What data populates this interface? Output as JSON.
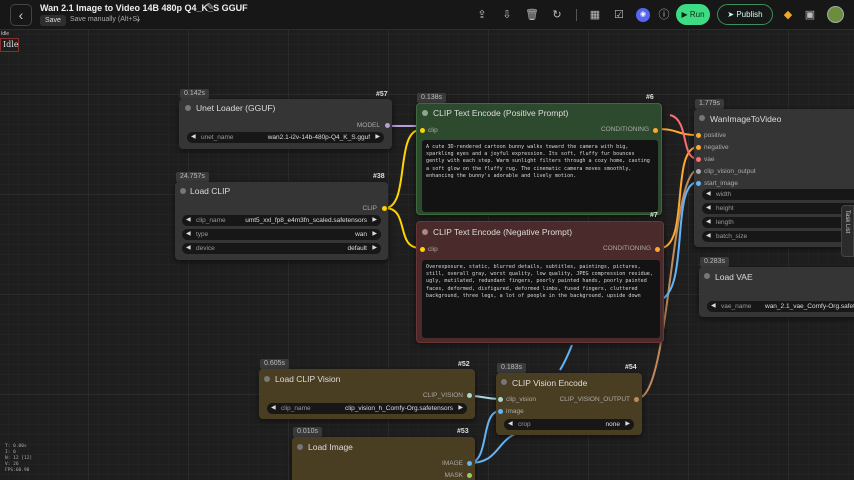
{
  "topbar": {
    "title": "Wan 2.1 Image to Video 14B 480p Q4_K_S GGUF",
    "save_label": "Save",
    "save_manually": "Save manually (Alt+S)",
    "run_label": "Run",
    "publish_label": "Publish"
  },
  "status": {
    "idle_small": "Idle",
    "idle_box": "Idle"
  },
  "stats": {
    "line1": "T: 0.00s",
    "line2": "I: 0",
    "line3": "N: 12 [12]",
    "line4": "V: 26",
    "line5": "FPS:60.98"
  },
  "nodes": {
    "unet_loader": {
      "timing": "0.142s",
      "id": "#57",
      "title": "Unet Loader (GGUF)",
      "output": "MODEL",
      "widgets": [
        {
          "name": "unet_name",
          "value": "wan2.1-i2v-14b-480p-Q4_K_S.gguf"
        }
      ]
    },
    "load_clip": {
      "timing": "24.757s",
      "id": "#38",
      "title": "Load CLIP",
      "output": "CLIP",
      "widgets": [
        {
          "name": "clip_name",
          "value": "umt5_xxl_fp8_e4m3fn_scaled.safetensors"
        },
        {
          "name": "type",
          "value": "wan"
        },
        {
          "name": "device",
          "value": "default"
        }
      ]
    },
    "clip_pos": {
      "timing": "0.138s",
      "id": "#6",
      "title": "CLIP Text Encode (Positive Prompt)",
      "input": "clip",
      "output": "CONDITIONING",
      "text": "A cute 3D-rendered cartoon bunny walks toward the camera with big, sparkling eyes and a joyful expression. Its soft, fluffy fur bounces gently with each step. Warm sunlight filters through a cozy home, casting a soft glow on the fluffy rug. The cinematic camera moves smoothly, enhancing the bunny's adorable and lively motion."
    },
    "clip_neg": {
      "id": "#7",
      "title": "CLIP Text Encode (Negative Prompt)",
      "input": "clip",
      "output": "CONDITIONING",
      "text": "Overexposure, static, blurred details, subtitles, paintings, pictures, still, overall gray, worst quality, low quality, JPEG compression residue, ugly, mutilated, redundant fingers, poorly painted hands, poorly painted faces, deformed, disfigured, deformed limbs, fused fingers, cluttered background, three legs, a lot of people in the background, upside down"
    },
    "wan_i2v": {
      "timing": "1.779s",
      "title": "WanImageToVideo",
      "inputs": [
        "positive",
        "negative",
        "vae",
        "clip_vision_output",
        "start_image"
      ],
      "widgets": [
        "width",
        "height",
        "length",
        "batch_size"
      ]
    },
    "load_vae": {
      "timing": "0.283s",
      "title": "Load VAE",
      "widgets": [
        {
          "name": "vae_name",
          "value": "wan_2.1_vae_Comfy-Org.safet"
        }
      ]
    },
    "load_clip_vision": {
      "timing": "0.605s",
      "id": "#52",
      "title": "Load CLIP Vision",
      "output": "CLIP_VISION",
      "widgets": [
        {
          "name": "clip_name",
          "value": "clip_vision_h_Comfy-Org.safetensors"
        }
      ]
    },
    "clip_vision_encode": {
      "timing": "0.183s",
      "id": "#54",
      "title": "CLIP Vision Encode",
      "inputs": [
        "clip_vision",
        "image"
      ],
      "output": "CLIP_VISION_OUTPUT",
      "widgets": [
        {
          "name": "crop",
          "value": "none"
        }
      ]
    },
    "load_image": {
      "timing": "0.010s",
      "id": "#53",
      "title": "Load Image",
      "outputs": [
        "IMAGE",
        "MASK"
      ]
    }
  },
  "task_list_label": "Task List",
  "colors": {
    "clip_wire": "#ffd500",
    "conditioning_wire": "#ffa931",
    "vision_wire": "#a8dadc",
    "image_wire": "#64b5f6",
    "model_wire": "#b39ddb",
    "vae_wire": "#ff6e6e",
    "positive_node": "#2e4a2e",
    "negative_node": "#4a2a2a",
    "loader_node": "#4a3e22"
  }
}
